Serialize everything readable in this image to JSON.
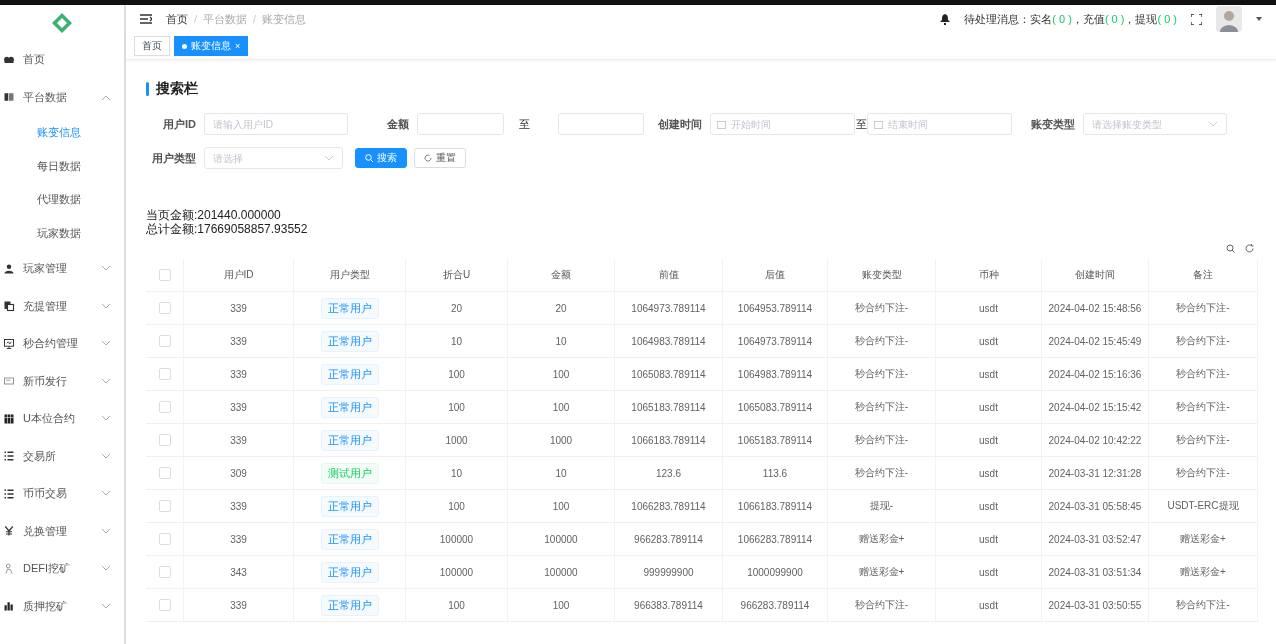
{
  "sidebar": {
    "items": [
      {
        "label": "首页"
      },
      {
        "label": "平台数据",
        "expanded": true,
        "children": [
          {
            "label": "账变信息",
            "selected": true
          },
          {
            "label": "每日数据",
            "selected": false
          },
          {
            "label": "代理数据",
            "selected": false
          },
          {
            "label": "玩家数据",
            "selected": false
          }
        ]
      },
      {
        "label": "玩家管理",
        "expanded": false
      },
      {
        "label": "充提管理",
        "expanded": false
      },
      {
        "label": "秒合约管理",
        "expanded": false
      },
      {
        "label": "新币发行",
        "expanded": false
      },
      {
        "label": "U本位合约",
        "expanded": false
      },
      {
        "label": "交易所",
        "expanded": false
      },
      {
        "label": "币币交易",
        "expanded": false
      },
      {
        "label": "兑换管理",
        "expanded": false
      },
      {
        "label": "DEFI挖矿",
        "expanded": false
      },
      {
        "label": "质押挖矿",
        "expanded": false
      }
    ]
  },
  "header": {
    "breadcrumb": [
      "首页",
      "平台数据",
      "账变信息"
    ],
    "breadcrumb_separator": "/",
    "pending": {
      "label": "待处理消息：",
      "items": [
        {
          "name": "实名",
          "count": "( 0 )",
          "separator": "，"
        },
        {
          "name": "充值",
          "count": "( 0 )",
          "separator": "，"
        },
        {
          "name": "提现",
          "count": "( 0 )"
        }
      ]
    }
  },
  "tabs": [
    {
      "label": "首页",
      "selected": false
    },
    {
      "label": "账变信息",
      "selected": true,
      "close": "×"
    }
  ],
  "search_bar": {
    "title": "搜索栏",
    "user_id": {
      "label": "用户ID",
      "placeholder": "请输入用户ID"
    },
    "amount": {
      "label": "金额",
      "to": "至"
    },
    "created": {
      "label": "创建时间",
      "start_placeholder": "开始时间",
      "to": "至",
      "end_placeholder": "结束时间"
    },
    "change_type": {
      "label": "账变类型",
      "placeholder": "请选择账变类型"
    },
    "user_type": {
      "label": "用户类型",
      "placeholder": "请选择"
    },
    "buttons": [
      {
        "kind": "primary",
        "label": "搜索"
      },
      {
        "kind": "default",
        "label": "重置"
      }
    ]
  },
  "totals": [
    "当页金额:201440.000000",
    "总计金额:17669058857.93552"
  ],
  "table": {
    "select_all_checked": false,
    "columns": [
      "用户ID",
      "用户类型",
      "折合U",
      "金额",
      "前值",
      "后值",
      "账变类型",
      "币种",
      "创建时间",
      "备注"
    ],
    "rows": [
      {
        "checked": false,
        "user_id": "339",
        "user_type": {
          "kind": "normal",
          "label": "正常用户"
        },
        "u": "20",
        "amount": "20",
        "before": "1064973.789114",
        "after": "1064953.789114",
        "change_type": "秒合约下注-",
        "coin": "usdt",
        "created": "2024-04-02 15:48:56",
        "note": "秒合约下注-"
      },
      {
        "checked": false,
        "user_id": "339",
        "user_type": {
          "kind": "normal",
          "label": "正常用户"
        },
        "u": "10",
        "amount": "10",
        "before": "1064983.789114",
        "after": "1064973.789114",
        "change_type": "秒合约下注-",
        "coin": "usdt",
        "created": "2024-04-02 15:45:49",
        "note": "秒合约下注-"
      },
      {
        "checked": false,
        "user_id": "339",
        "user_type": {
          "kind": "normal",
          "label": "正常用户"
        },
        "u": "100",
        "amount": "100",
        "before": "1065083.789114",
        "after": "1064983.789114",
        "change_type": "秒合约下注-",
        "coin": "usdt",
        "created": "2024-04-02 15:16:36",
        "note": "秒合约下注-"
      },
      {
        "checked": false,
        "user_id": "339",
        "user_type": {
          "kind": "normal",
          "label": "正常用户"
        },
        "u": "100",
        "amount": "100",
        "before": "1065183.789114",
        "after": "1065083.789114",
        "change_type": "秒合约下注-",
        "coin": "usdt",
        "created": "2024-04-02 15:15:42",
        "note": "秒合约下注-"
      },
      {
        "checked": false,
        "user_id": "339",
        "user_type": {
          "kind": "normal",
          "label": "正常用户"
        },
        "u": "1000",
        "amount": "1000",
        "before": "1066183.789114",
        "after": "1065183.789114",
        "change_type": "秒合约下注-",
        "coin": "usdt",
        "created": "2024-04-02 10:42:22",
        "note": "秒合约下注-"
      },
      {
        "checked": false,
        "user_id": "309",
        "user_type": {
          "kind": "test",
          "label": "测试用户"
        },
        "u": "10",
        "amount": "10",
        "before": "123.6",
        "after": "113.6",
        "change_type": "秒合约下注-",
        "coin": "usdt",
        "created": "2024-03-31 12:31:28",
        "note": "秒合约下注-"
      },
      {
        "checked": false,
        "user_id": "339",
        "user_type": {
          "kind": "normal",
          "label": "正常用户"
        },
        "u": "100",
        "amount": "100",
        "before": "1066283.789114",
        "after": "1066183.789114",
        "change_type": "提现-",
        "coin": "usdt",
        "created": "2024-03-31 05:58:45",
        "note": "USDT-ERC提现"
      },
      {
        "checked": false,
        "user_id": "339",
        "user_type": {
          "kind": "normal",
          "label": "正常用户"
        },
        "u": "100000",
        "amount": "100000",
        "before": "966283.789114",
        "after": "1066283.789114",
        "change_type": "赠送彩金+",
        "coin": "usdt",
        "created": "2024-03-31 03:52:47",
        "note": "赠送彩金+"
      },
      {
        "checked": false,
        "user_id": "343",
        "user_type": {
          "kind": "normal",
          "label": "正常用户"
        },
        "u": "100000",
        "amount": "100000",
        "before": "999999900",
        "after": "1000099900",
        "change_type": "赠送彩金+",
        "coin": "usdt",
        "created": "2024-03-31 03:51:34",
        "note": "赠送彩金+"
      },
      {
        "checked": false,
        "user_id": "339",
        "user_type": {
          "kind": "normal",
          "label": "正常用户"
        },
        "u": "100",
        "amount": "100",
        "before": "966383.789114",
        "after": "966283.789114",
        "change_type": "秒合约下注-",
        "coin": "usdt",
        "created": "2024-03-31 03:50:55",
        "note": "秒合约下注-"
      }
    ]
  }
}
